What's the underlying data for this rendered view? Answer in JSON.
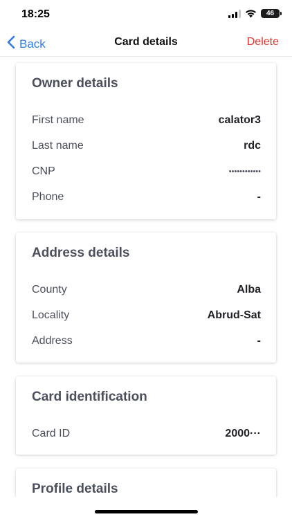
{
  "status_bar": {
    "time": "18:25",
    "battery": "46"
  },
  "nav": {
    "back_label": "Back",
    "title": "Card details",
    "delete_label": "Delete"
  },
  "owner_details": {
    "title": "Owner details",
    "rows": [
      {
        "label": "First name",
        "value": "calator3"
      },
      {
        "label": "Last name",
        "value": "rdc"
      },
      {
        "label": "CNP",
        "value": "••••••••••••"
      },
      {
        "label": "Phone",
        "value": "-"
      }
    ]
  },
  "address_details": {
    "title": "Address details",
    "rows": [
      {
        "label": "County",
        "value": "Alba"
      },
      {
        "label": "Locality",
        "value": "Abrud-Sat"
      },
      {
        "label": "Address",
        "value": "-"
      }
    ]
  },
  "card_identification": {
    "title": "Card identification",
    "rows": [
      {
        "label": "Card ID",
        "value": "2000···"
      }
    ]
  },
  "profile_details": {
    "title": "Profile details"
  },
  "colors": {
    "accent": "#2f7bea",
    "destructive": "#e5322d",
    "label": "#4b4e5c"
  }
}
